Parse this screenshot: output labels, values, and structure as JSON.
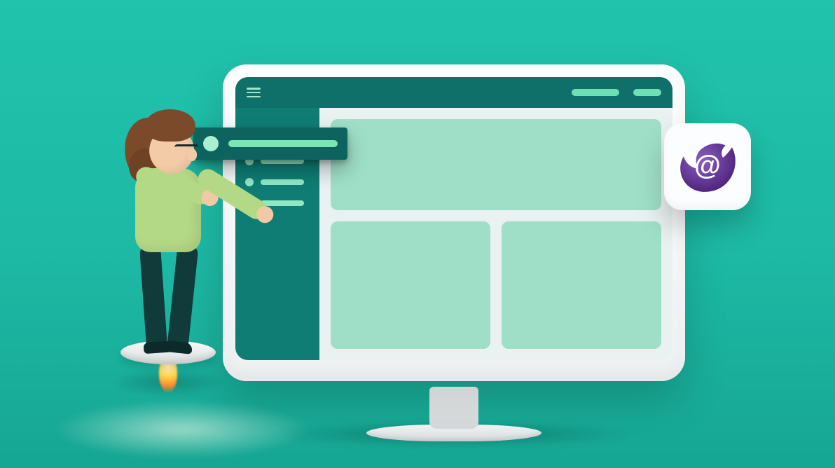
{
  "colors": {
    "bg_top": "#21c3ac",
    "bg_bottom": "#16a693",
    "topbar": "#0f6f69",
    "sidebar": "#0f7d74",
    "chip": "#0d645e",
    "accent_pill": "#6fe0b3",
    "accent_dot": "#8fe7c5",
    "card": "#9fdfc8",
    "bezel": "#fdfefe",
    "blazor_purple": "#5c2d91"
  },
  "app": {
    "topbar": {
      "hamburger": "menu",
      "right_pills": 2
    },
    "sidebar": {
      "item_count": 4
    },
    "active_nav_item": {
      "extracted": true
    },
    "content": {
      "cards": [
        "wide",
        "left",
        "right"
      ]
    }
  },
  "badge": {
    "name": "blazor-logo",
    "glyph": "@"
  },
  "character": {
    "pose": "placing-nav-item",
    "hair": "brown-ponytail",
    "top_color": "#b4d986",
    "pants_color": "#113b3a",
    "platform": "hover-disc-with-flame"
  }
}
